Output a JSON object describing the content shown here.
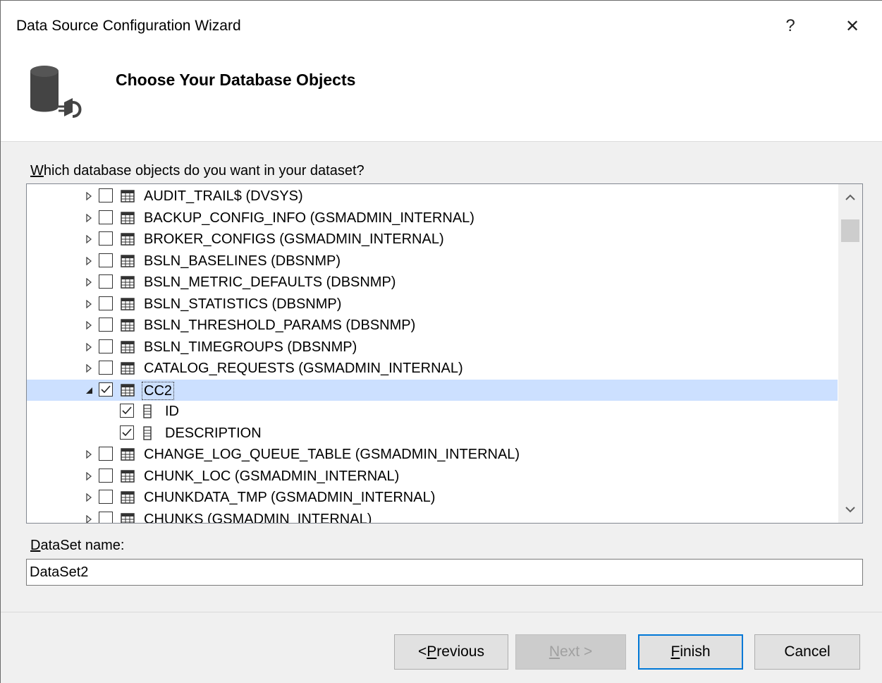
{
  "window": {
    "title": "Data Source Configuration Wizard",
    "help_glyph": "?",
    "close_glyph": "✕"
  },
  "header": {
    "title": "Choose Your Database Objects",
    "icon": "database-connection-icon"
  },
  "prompt": {
    "accel": "W",
    "rest": "hich database objects do you want in your dataset?"
  },
  "tree": {
    "rows": [
      {
        "label": "AUDIT_TRAIL$ (DVSYS)",
        "level": 0,
        "checked": false,
        "expanded": false,
        "type": "table"
      },
      {
        "label": "BACKUP_CONFIG_INFO (GSMADMIN_INTERNAL)",
        "level": 0,
        "checked": false,
        "expanded": false,
        "type": "table"
      },
      {
        "label": "BROKER_CONFIGS (GSMADMIN_INTERNAL)",
        "level": 0,
        "checked": false,
        "expanded": false,
        "type": "table"
      },
      {
        "label": "BSLN_BASELINES (DBSNMP)",
        "level": 0,
        "checked": false,
        "expanded": false,
        "type": "table"
      },
      {
        "label": "BSLN_METRIC_DEFAULTS (DBSNMP)",
        "level": 0,
        "checked": false,
        "expanded": false,
        "type": "table"
      },
      {
        "label": "BSLN_STATISTICS (DBSNMP)",
        "level": 0,
        "checked": false,
        "expanded": false,
        "type": "table"
      },
      {
        "label": "BSLN_THRESHOLD_PARAMS (DBSNMP)",
        "level": 0,
        "checked": false,
        "expanded": false,
        "type": "table"
      },
      {
        "label": "BSLN_TIMEGROUPS (DBSNMP)",
        "level": 0,
        "checked": false,
        "expanded": false,
        "type": "table"
      },
      {
        "label": "CATALOG_REQUESTS (GSMADMIN_INTERNAL)",
        "level": 0,
        "checked": false,
        "expanded": false,
        "type": "table"
      },
      {
        "label": "CC2",
        "level": 0,
        "checked": true,
        "expanded": true,
        "type": "table",
        "selected": true
      },
      {
        "label": "ID",
        "level": 1,
        "checked": true,
        "type": "column"
      },
      {
        "label": "DESCRIPTION",
        "level": 1,
        "checked": true,
        "type": "column"
      },
      {
        "label": "CHANGE_LOG_QUEUE_TABLE (GSMADMIN_INTERNAL)",
        "level": 0,
        "checked": false,
        "expanded": false,
        "type": "table"
      },
      {
        "label": "CHUNK_LOC (GSMADMIN_INTERNAL)",
        "level": 0,
        "checked": false,
        "expanded": false,
        "type": "table"
      },
      {
        "label": "CHUNKDATA_TMP (GSMADMIN_INTERNAL)",
        "level": 0,
        "checked": false,
        "expanded": false,
        "type": "table"
      },
      {
        "label": "CHUNKS (GSMADMIN_INTERNAL)",
        "level": 0,
        "checked": false,
        "expanded": false,
        "type": "table"
      }
    ]
  },
  "dataset": {
    "label_accel": "D",
    "label_rest": "ataSet name:",
    "value": "DataSet2"
  },
  "buttons": {
    "previous": {
      "prefix": "< ",
      "accel": "P",
      "rest": "revious"
    },
    "next": {
      "accel": "N",
      "rest": "ext >",
      "disabled": true
    },
    "finish": {
      "accel": "F",
      "rest": "inish"
    },
    "cancel": {
      "label": "Cancel"
    }
  },
  "colors": {
    "selection": "#cce0ff",
    "default_button_border": "#0078d7"
  }
}
